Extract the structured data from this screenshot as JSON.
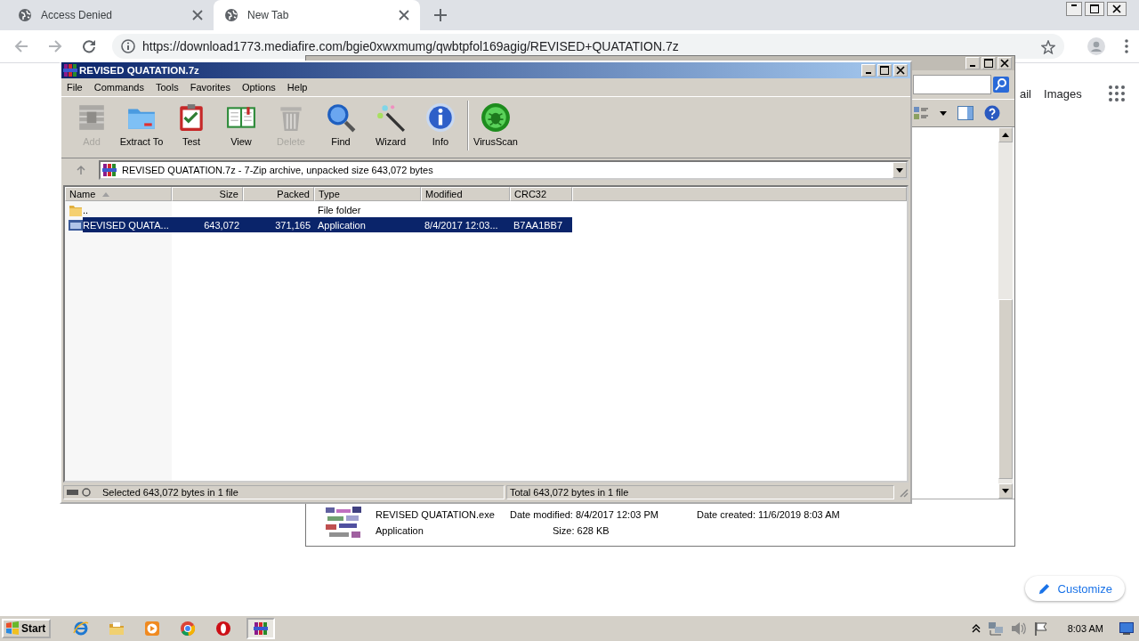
{
  "browser": {
    "tabs": [
      {
        "title": "Access Denied",
        "selected": false
      },
      {
        "title": "New Tab",
        "selected": true
      }
    ],
    "url": "https://download1773.mediafire.com/bgie0xwxmumg/qwbtpfol169agig/REVISED+QUATATION.7z",
    "header_links": [
      "ail",
      "Images"
    ],
    "customize_button": "Customize"
  },
  "explorer": {
    "details": {
      "name": "REVISED QUATATION.exe",
      "type": "Application",
      "date_modified": "Date modified: 8/4/2017 12:03 PM",
      "size": "Size: 628 KB",
      "date_created": "Date created: 11/6/2019 8:03 AM"
    }
  },
  "archiver": {
    "title": "REVISED QUATATION.7z",
    "menu": [
      "File",
      "Commands",
      "Tools",
      "Favorites",
      "Options",
      "Help"
    ],
    "toolbar": [
      {
        "label": "Add",
        "kind": "add",
        "disabled": true
      },
      {
        "label": "Extract To",
        "kind": "extract",
        "disabled": false
      },
      {
        "label": "Test",
        "kind": "test",
        "disabled": false
      },
      {
        "label": "View",
        "kind": "view",
        "disabled": false
      },
      {
        "label": "Delete",
        "kind": "delete",
        "disabled": true
      },
      {
        "label": "Find",
        "kind": "find",
        "disabled": false
      },
      {
        "label": "Wizard",
        "kind": "wizard",
        "disabled": false
      },
      {
        "label": "Info",
        "kind": "info",
        "disabled": false
      },
      {
        "label": "VirusScan",
        "kind": "virus",
        "disabled": false
      }
    ],
    "path": "REVISED QUATATION.7z - 7-Zip archive, unpacked size 643,072 bytes",
    "columns": [
      "Name",
      "Size",
      "Packed",
      "Type",
      "Modified",
      "CRC32"
    ],
    "rows": [
      {
        "kind": "folder",
        "name": "..",
        "type": "File folder",
        "selected": false
      },
      {
        "kind": "application",
        "name": "REVISED QUATA...",
        "size": "643,072",
        "packed": "371,165",
        "type": "Application",
        "modified": "8/4/2017 12:03...",
        "crc32": "B7AA1BB7",
        "selected": true
      }
    ],
    "status_left": "Selected 643,072 bytes in 1 file",
    "status_right": "Total 643,072 bytes in 1 file"
  },
  "taskbar": {
    "start": "Start",
    "apps": [
      {
        "kind": "ie",
        "selected": false
      },
      {
        "kind": "folder",
        "selected": false
      },
      {
        "kind": "media",
        "selected": false
      },
      {
        "kind": "chrome",
        "selected": false
      },
      {
        "kind": "opera",
        "selected": false
      },
      {
        "kind": "winrar",
        "selected": true
      }
    ],
    "clock": "8:03 AM"
  }
}
